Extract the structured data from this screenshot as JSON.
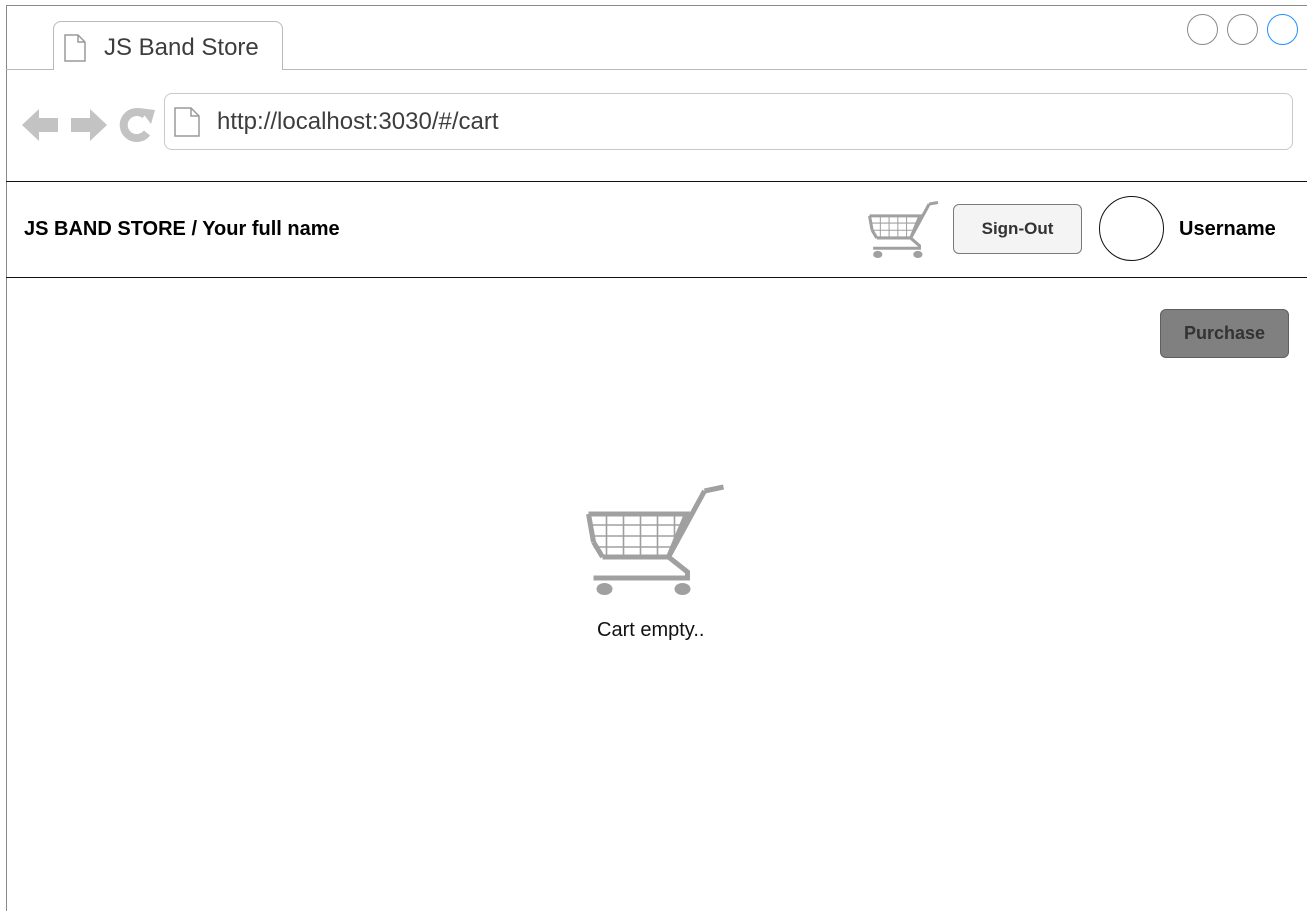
{
  "browser": {
    "tab_title": "JS Band Store",
    "url": "http://localhost:3030/#/cart"
  },
  "header": {
    "brand": "JS BAND STORE / Your full name",
    "sign_out_label": "Sign-Out",
    "username": "Username"
  },
  "main": {
    "purchase_label": "Purchase",
    "empty_message": "Cart empty.."
  },
  "icons": {
    "tab_page": "page-icon",
    "back": "arrow-left-icon",
    "forward": "arrow-right-icon",
    "reload": "reload-icon",
    "address_page": "page-icon",
    "header_cart": "shopping-cart-icon",
    "empty_cart": "shopping-cart-icon"
  },
  "colors": {
    "icon_gray": "#a0a0a0",
    "active_window_button": "#1e90ff",
    "purchase_button": "#808080"
  }
}
